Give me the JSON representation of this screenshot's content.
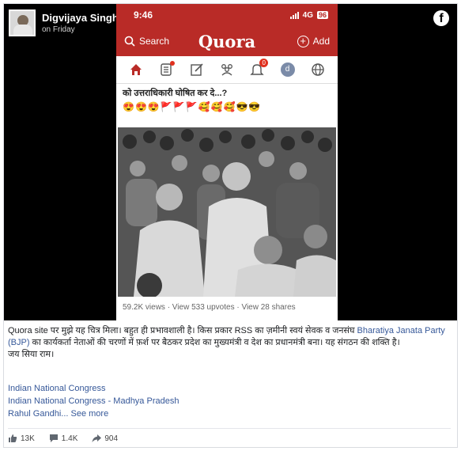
{
  "post": {
    "author": "Digvijaya Singh",
    "time": "on Friday",
    "caption_part1": "Quora site पर मुझे यह चित्र मिला। बहुत ही प्रभावशाली है। किस प्रकार RSS का ज़मीनी स्वयं सेवक व जनसंघ ",
    "caption_link": "Bharatiya Janata Party (BJP)",
    "caption_part2": " का कार्यकर्ता नेताओं की चरणों में फ़र्श पर बैठकर प्रदेश का मुख्यमंत्री व देश का प्रधानमंत्री बना। यह संगठन की शक्ति है।",
    "caption_line2": "जय सिया राम।",
    "tags": [
      "Indian National Congress",
      "Indian National Congress - Madhya Pradesh",
      "Rahul Gandhi..."
    ],
    "see_more": "See more",
    "reactions": "13K",
    "comments": "1.4K",
    "shares": "904"
  },
  "screenshot": {
    "time": "9:46",
    "network": "4G",
    "battery": "96",
    "search_label": "Search",
    "logo": "Quora",
    "add_label": "Add",
    "notif_count": "0",
    "avatar_letter": "d",
    "post_text": "को उत्तराधिकारी घोषित कर दे...?",
    "emoji_line": "😍😍😍🚩🚩🚩🥰🥰🥰😎😎",
    "stats": "59.2K views · View 533 upvotes · View 28 shares"
  },
  "colors": {
    "quora_red": "#b92b27",
    "link_blue": "#365899"
  }
}
